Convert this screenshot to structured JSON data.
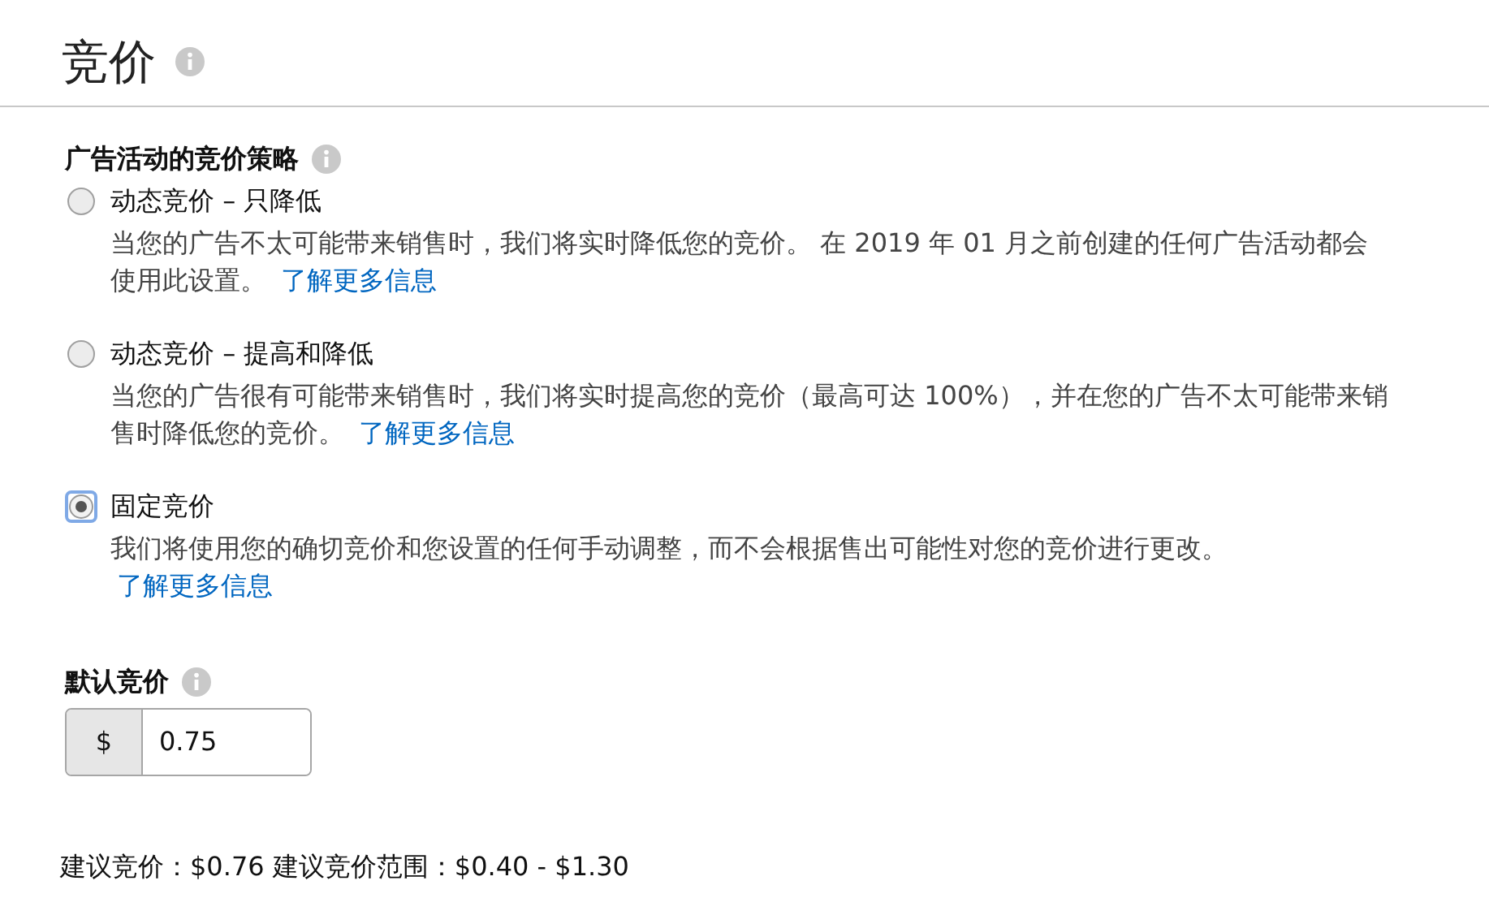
{
  "title": "竞价",
  "strategy": {
    "label": "广告活动的竞价策略",
    "options": [
      {
        "label": "动态竞价 – 只降低",
        "selected": false,
        "description": "当您的广告不太可能带来销售时，我们将实时降低您的竞价。 在 2019 年 01 月之前创建的任何广告活动都会使用此设置。",
        "link": "了解更多信息"
      },
      {
        "label": "动态竞价 – 提高和降低",
        "selected": false,
        "description": "当您的广告很有可能带来销售时，我们将实时提高您的竞价（最高可达 100%），并在您的广告不太可能带来销售时降低您的竞价。",
        "link": "了解更多信息"
      },
      {
        "label": "固定竞价",
        "selected": true,
        "description": "我们将使用您的确切竞价和您设置的任何手动调整，而不会根据售出可能性对您的竞价进行更改。",
        "link": "了解更多信息"
      }
    ]
  },
  "default_bid": {
    "label": "默认竞价",
    "prefix": "$",
    "value": "0.75"
  },
  "suggestion": "建议竞价：$0.76 建议竞价范围：$0.40 - $1.30"
}
